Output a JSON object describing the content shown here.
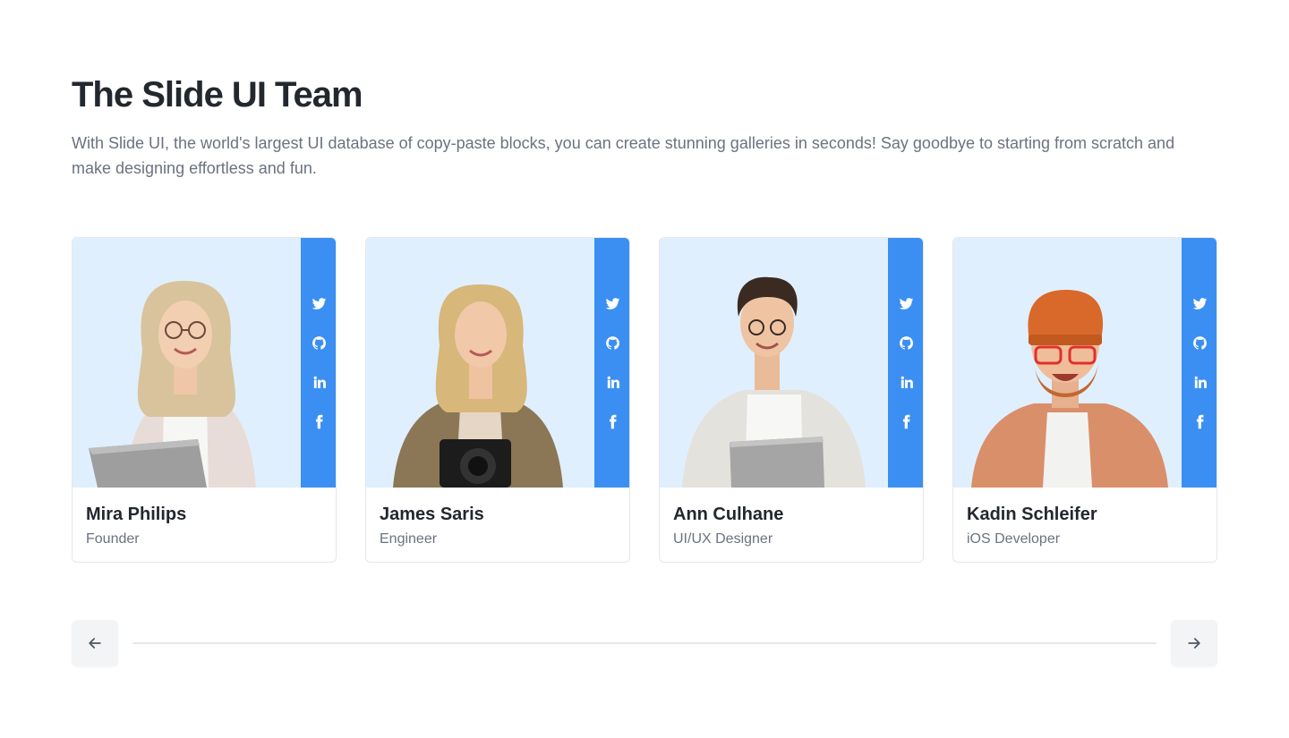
{
  "header": {
    "title": "The Slide UI Team",
    "description": "With Slide UI, the world's largest UI database of copy-paste blocks, you can create stunning galleries in seconds! Say goodbye to starting from scratch and make designing effortless and fun."
  },
  "colors": {
    "accent": "#3b8ff2",
    "photo_background": "#e0effd",
    "heading": "#23272e",
    "muted_text": "#6b7280"
  },
  "social_icons": [
    "twitter-icon",
    "github-icon",
    "linkedin-icon",
    "facebook-icon"
  ],
  "team": [
    {
      "name": "Mira Philips",
      "role": "Founder"
    },
    {
      "name": "James Saris",
      "role": "Engineer"
    },
    {
      "name": "Ann Culhane",
      "role": "UI/UX Designer"
    },
    {
      "name": "Kadin Schleifer",
      "role": "iOS Developer"
    }
  ],
  "carousel": {
    "prev_icon": "arrow-left-icon",
    "next_icon": "arrow-right-icon"
  }
}
